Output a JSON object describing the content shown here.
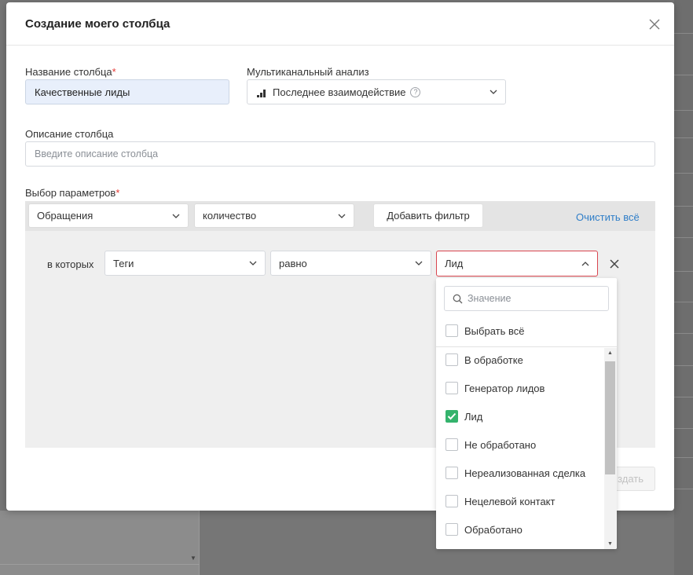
{
  "modal": {
    "title": "Создание моего столбца"
  },
  "form": {
    "column_name_label": "Название столбца",
    "column_name_value": "Качественные лиды",
    "multichannel_label": "Мультиканальный анализ",
    "multichannel_value": "Последнее взаимодействие",
    "description_label": "Описание столбца",
    "description_placeholder": "Введите описание столбца",
    "params_label": "Выбор параметров",
    "required_mark": "*"
  },
  "params": {
    "source_select": "Обращения",
    "metric_select": "количество",
    "add_filter_button": "Добавить фильтр",
    "clear_all_link": "Очистить всё"
  },
  "filter": {
    "prefix": "в которых",
    "field_select": "Теги",
    "operator_select": "равно",
    "value_select": "Лид"
  },
  "dropdown": {
    "search_placeholder": "Значение",
    "select_all": "Выбрать всё",
    "options": [
      {
        "label": "В обработке",
        "checked": false
      },
      {
        "label": "Генератор лидов",
        "checked": false
      },
      {
        "label": "Лид",
        "checked": true
      },
      {
        "label": "Не обработано",
        "checked": false
      },
      {
        "label": "Нереализованная сделка",
        "checked": false
      },
      {
        "label": "Нецелевой контакт",
        "checked": false
      },
      {
        "label": "Обработано",
        "checked": false
      }
    ]
  },
  "footer": {
    "create_button_partial": "здать"
  },
  "colors": {
    "accent_link": "#2f7ec8",
    "checkbox_checked": "#34b36c",
    "required": "#e53935",
    "active_select_border": "#d9454f"
  }
}
